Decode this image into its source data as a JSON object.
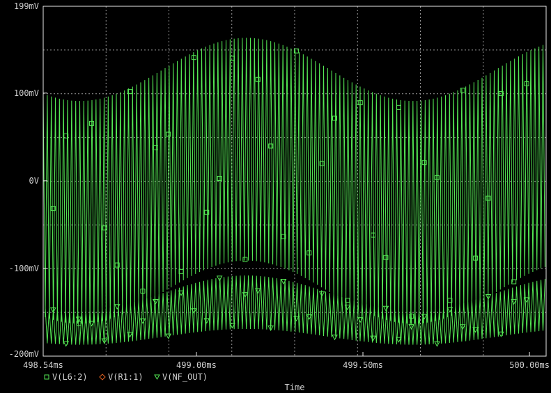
{
  "chart_data": {
    "type": "line",
    "title": "",
    "xlabel": "Time",
    "ylabel": "",
    "x_unit": "ms",
    "xlim": [
      498.54,
      500.05
    ],
    "ylim": [
      -200,
      199
    ],
    "y_unit": "mV",
    "grid": true,
    "x_ticks": [
      {
        "value": 498.54,
        "label": "498.54ms"
      },
      {
        "value": 499.0,
        "label": "499.00ms"
      },
      {
        "value": 499.5,
        "label": "499.50ms"
      },
      {
        "value": 500.0,
        "label": "500.00ms"
      }
    ],
    "y_ticks": [
      {
        "value": 199,
        "label": "199mV"
      },
      {
        "value": 100,
        "label": "100mV"
      },
      {
        "value": 0,
        "label": "0V"
      },
      {
        "value": -100,
        "label": "-100mV"
      },
      {
        "value": -200,
        "label": "-200mV"
      }
    ],
    "carrier_period_ms": 0.0122,
    "series": [
      {
        "name": "V(L6:2)",
        "marker": "square",
        "color": "#54e854",
        "envelope_upper": {
          "mean": 127,
          "amplitude": 36,
          "period_ms": 1.0,
          "peak_ms": 499.15
        },
        "envelope_lower": {
          "mean": -127,
          "amplitude": 36,
          "period_ms": 1.0,
          "peak_ms": 499.15
        }
      },
      {
        "name": "V(R1:1)",
        "marker": "diamond",
        "color": "#e06020",
        "envelope_upper": {
          "mean": 0,
          "amplitude": 0,
          "period_ms": 1.0,
          "peak_ms": 499.15
        },
        "envelope_lower": {
          "mean": 0,
          "amplitude": 0,
          "period_ms": 1.0,
          "peak_ms": 499.15
        }
      },
      {
        "name": "V(NF_OUT)",
        "marker": "triangle-down",
        "color": "#54e854",
        "envelope_upper": {
          "mean": -128,
          "amplitude": 20,
          "period_ms": 1.0,
          "peak_ms": 499.15
        },
        "envelope_lower": {
          "mean": -178,
          "amplitude": 9,
          "period_ms": 1.0,
          "peak_ms": 499.15
        }
      }
    ],
    "legend": [
      {
        "marker": "square",
        "label": "V(L6:2)",
        "color": "#54e854"
      },
      {
        "marker": "diamond",
        "label": "V(R1:1)",
        "color": "#e06020"
      },
      {
        "marker": "triangle-down",
        "label": "V(NF_OUT)",
        "color": "#54e854"
      }
    ],
    "legend_position": "bottom-left"
  },
  "colors": {
    "background": "#000000",
    "frame": "#e8e8e8",
    "grid": "#9a9a9a",
    "text": "#d0d0d0",
    "trace": "#54e854"
  }
}
